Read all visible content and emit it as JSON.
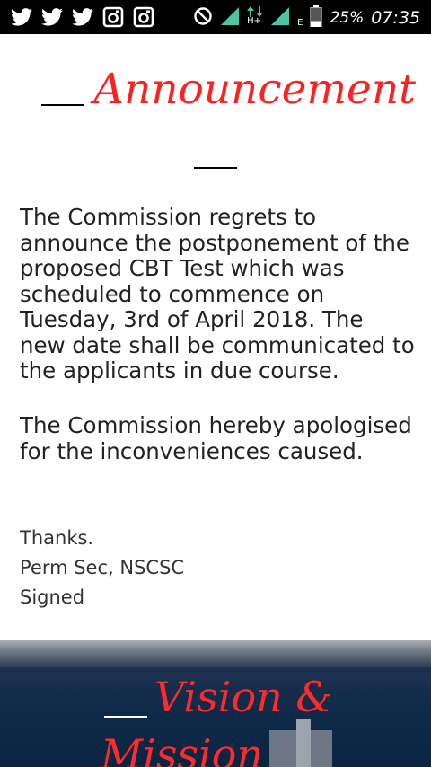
{
  "status_bar": {
    "battery": "25%",
    "time": "07:35",
    "network_label_1": "H+",
    "network_label_2": "E",
    "notification_icons": [
      "twitter-icon",
      "twitter-icon",
      "twitter-icon",
      "instagram-icon",
      "instagram-icon"
    ]
  },
  "announcement": {
    "title": "Announcement",
    "paragraph1": "The Commission regrets to announce the postponement of the proposed CBT Test which was scheduled to commence on Tuesday, 3rd of April 2018. The new date shall be communicated to the applicants in due course.",
    "paragraph2": "The Commission hereby apologised for the inconveniences caused.",
    "signature": [
      "Thanks.",
      "Perm Sec, NSCSC",
      "Signed"
    ]
  },
  "banner": {
    "title_line1": "Vision &",
    "title_line2": "Mission"
  },
  "colors": {
    "accent": "#ff2020",
    "banner_bg": "#0e2948"
  }
}
